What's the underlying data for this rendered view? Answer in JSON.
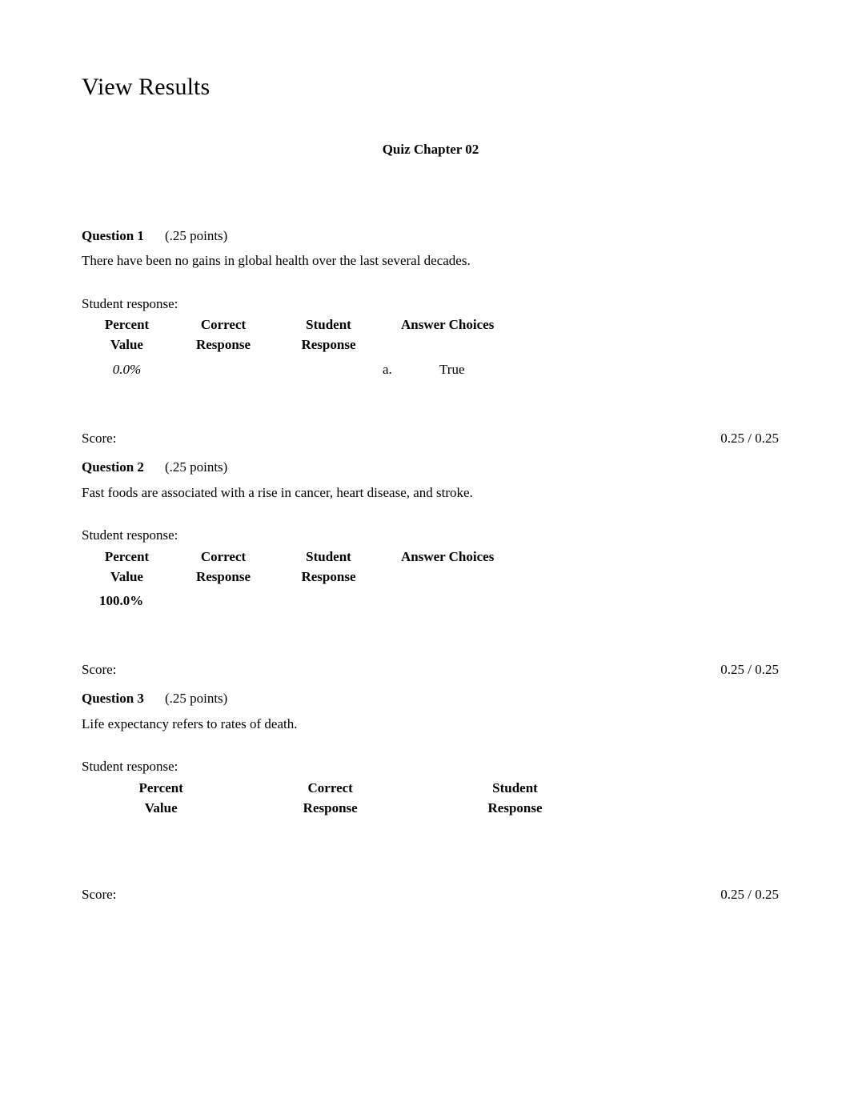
{
  "document": {
    "title": "View Results",
    "quiz_title": "Quiz Chapter 02"
  },
  "table_headers": {
    "percent_value": "Percent\nValue",
    "correct_response": "Correct\nResponse",
    "student_response": "Student\nResponse",
    "answer_choices": "Answer Choices"
  },
  "labels": {
    "student_response": "Student response:",
    "score": "Score:"
  },
  "questions": [
    {
      "label": "Question 1",
      "points": "(.25 points)",
      "text": "There have been no gains in global health over the last several decades.",
      "student_response_label": "Student response:",
      "columns": [
        "Percent\nValue",
        "Correct\nResponse",
        "Student\nResponse",
        "Answer Choices"
      ],
      "rows": [
        {
          "percent_value": "0.0%",
          "percent_style": "italic",
          "correct_response": "",
          "student_response": "",
          "choice_letter": "a.",
          "answer_choice": "True"
        }
      ],
      "score_label": "Score:",
      "score_value": "0.25 / 0.25"
    },
    {
      "label": "Question 2",
      "points": "(.25 points)",
      "text": "Fast foods are associated with a rise in cancer, heart disease, and stroke.",
      "student_response_label": "Student response:",
      "columns": [
        "Percent\nValue",
        "Correct\nResponse",
        "Student\nResponse",
        "Answer Choices"
      ],
      "rows": [
        {
          "percent_value": "100.0%",
          "percent_style": "bold",
          "correct_response": "",
          "student_response": "",
          "choice_letter": "",
          "answer_choice": ""
        }
      ],
      "score_label": "Score:",
      "score_value": "0.25 / 0.25"
    },
    {
      "label": "Question 3",
      "points": "(.25 points)",
      "text": "Life expectancy refers to rates of death.",
      "student_response_label": "Student response:",
      "columns": [
        "Percent\nValue",
        "Correct\nResponse",
        "Student\nResponse"
      ],
      "rows": [],
      "score_label": "Score:",
      "score_value": "0.25 / 0.25"
    }
  ]
}
